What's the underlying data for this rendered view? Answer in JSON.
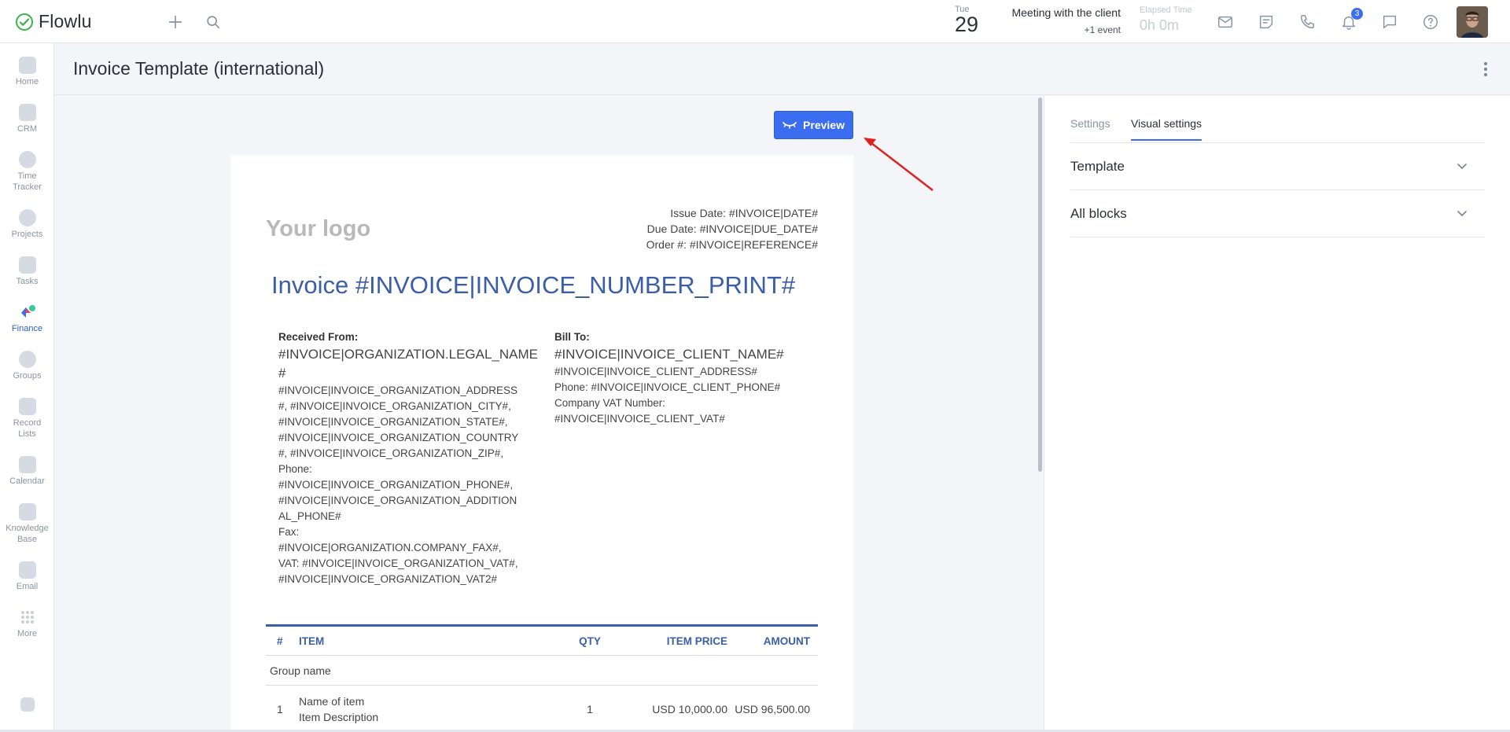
{
  "app": {
    "name": "Flowlu"
  },
  "topbar": {
    "date_day": "Tue",
    "date_num": "29",
    "event_title": "Meeting with the client",
    "event_more": "+1 event",
    "elapsed_label": "Elapsed Time",
    "elapsed_value": "0h 0m",
    "notification_count": "3"
  },
  "sidebar": {
    "items": [
      {
        "label": "Home",
        "icon": "home-icon"
      },
      {
        "label": "CRM",
        "icon": "crm-icon"
      },
      {
        "label": "Time Tracker",
        "icon": "time-tracker-icon"
      },
      {
        "label": "Projects",
        "icon": "projects-icon"
      },
      {
        "label": "Tasks",
        "icon": "tasks-icon"
      },
      {
        "label": "Finance",
        "icon": "finance-icon"
      },
      {
        "label": "Groups",
        "icon": "groups-icon"
      },
      {
        "label": "Record Lists",
        "icon": "record-lists-icon"
      },
      {
        "label": "Calendar",
        "icon": "calendar-icon"
      },
      {
        "label": "Knowledge Base",
        "icon": "knowledge-base-icon"
      },
      {
        "label": "Email",
        "icon": "email-icon"
      },
      {
        "label": "More",
        "icon": "more-grid-icon"
      }
    ]
  },
  "page": {
    "title": "Invoice Template (international)"
  },
  "preview_button": {
    "label": "Preview"
  },
  "invoice": {
    "logo_text": "Your logo",
    "issue_date": "Issue Date: #INVOICE|DATE#",
    "due_date": "Due Date: #INVOICE|DUE_DATE#",
    "order_num": "Order #: #INVOICE|REFERENCE#",
    "title": "Invoice #INVOICE|INVOICE_NUMBER_PRINT#",
    "from": {
      "heading": "Received From:",
      "name_1": "#INVOICE|ORGANIZATION.LEGAL_NAME",
      "name_2": "#",
      "lines": [
        "#INVOICE|INVOICE_ORGANIZATION_ADDRESS",
        "#, #INVOICE|INVOICE_ORGANIZATION_CITY#,",
        "#INVOICE|INVOICE_ORGANIZATION_STATE#,",
        "#INVOICE|INVOICE_ORGANIZATION_COUNTRY",
        "#, #INVOICE|INVOICE_ORGANIZATION_ZIP#,",
        "Phone:",
        "#INVOICE|INVOICE_ORGANIZATION_PHONE#,",
        "#INVOICE|INVOICE_ORGANIZATION_ADDITION",
        "AL_PHONE#",
        "Fax:",
        "#INVOICE|ORGANIZATION.COMPANY_FAX#,",
        "VAT: #INVOICE|INVOICE_ORGANIZATION_VAT#,",
        "#INVOICE|INVOICE_ORGANIZATION_VAT2#"
      ]
    },
    "bill": {
      "heading": "Bill To:",
      "name": "#INVOICE|INVOICE_CLIENT_NAME#",
      "lines": [
        "#INVOICE|INVOICE_CLIENT_ADDRESS#",
        "Phone: #INVOICE|INVOICE_CLIENT_PHONE#",
        "Company VAT Number:",
        "#INVOICE|INVOICE_CLIENT_VAT#"
      ]
    },
    "table": {
      "headers": {
        "num": "#",
        "item": "ITEM",
        "qty": "QTY",
        "price": "ITEM PRICE",
        "amount": "AMOUNT"
      },
      "group_name": "Group name",
      "row": {
        "num": "1",
        "name": "Name of item",
        "description": "Item Description",
        "qty": "1",
        "price": "USD 10,000.00",
        "amount": "USD 96,500.00"
      }
    }
  },
  "right_panel": {
    "tabs": [
      "Settings",
      "Visual settings"
    ],
    "sections": [
      "Template",
      "All blocks"
    ]
  },
  "colors": {
    "accent": "#3a6df0",
    "invoice_blue": "#3a5ea8",
    "annotation_arrow": "#e02020"
  }
}
